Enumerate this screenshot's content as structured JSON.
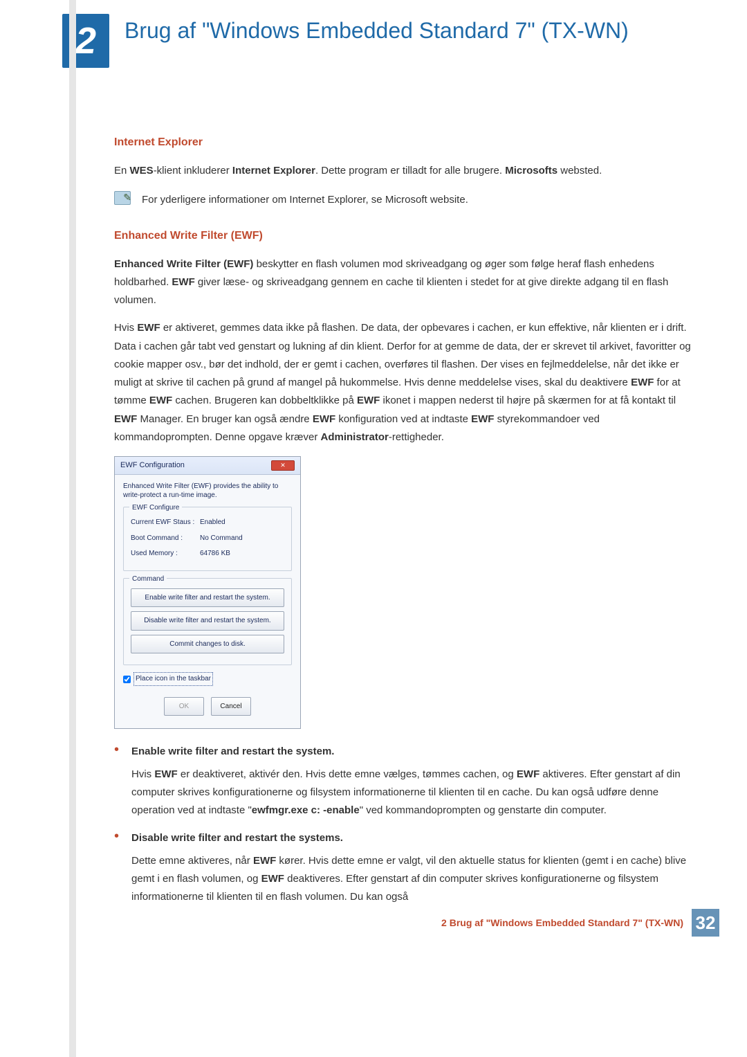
{
  "header": {
    "chapter_number": "2",
    "title": "Brug af \"Windows Embedded Standard 7\" (TX-WN)"
  },
  "section_ie": {
    "heading": "Internet Explorer",
    "para_parts": {
      "p1": "En ",
      "p2": "WES",
      "p3": "-klient inkluderer ",
      "p4": "Internet Explorer",
      "p5": ". Dette program er tilladt for alle brugere. ",
      "p6": "Microsofts",
      "p7": " websted."
    },
    "note": "For yderligere informationer om Internet Explorer, se Microsoft website."
  },
  "section_ewf": {
    "heading": "Enhanced Write Filter (EWF)",
    "para1_parts": {
      "a": "Enhanced Write Filter (EWF)",
      "b": " beskytter en flash volumen mod skriveadgang og øger som følge heraf flash enhedens holdbarhed. ",
      "c": "EWF",
      "d": " giver læse- og skriveadgang gennem en cache til klienten i stedet for at give direkte adgang til en flash volumen."
    },
    "para2_parts": {
      "a": "Hvis ",
      "b": "EWF",
      "c": " er aktiveret, gemmes data ikke på flashen. De data, der opbevares i cachen, er kun effektive, når klienten er i drift. Data i cachen går tabt ved genstart og lukning af din klient. Derfor for at gemme de data, der er skrevet til arkivet, favoritter og cookie mapper osv., bør det indhold, der er gemt i cachen, overføres til flashen. Der vises en fejlmeddelelse, når det ikke er muligt at skrive til cachen på grund af mangel på hukommelse. Hvis denne meddelelse vises, skal du deaktivere ",
      "d": "EWF",
      "e": " for at tømme ",
      "f": "EWF",
      "g": " cachen. Brugeren kan dobbeltklikke på ",
      "h": "EWF",
      "i": " ikonet i mappen nederst til højre på skærmen for at få kontakt til ",
      "j": "EWF",
      "k": " Manager. En bruger kan også ændre ",
      "l": "EWF",
      "m": " konfiguration ved at indtaste ",
      "n": "EWF",
      "o": " styrekommandoer ved kommandoprompten. Denne opgave kræver ",
      "p": "Administrator",
      "q": "-rettigheder."
    }
  },
  "dialog": {
    "title": "EWF Configuration",
    "description": "Enhanced Write Filter (EWF) provides the ability to write-protect a run-time image.",
    "group1_legend": "EWF Configure",
    "rows": {
      "status_label": "Current EWF Staus :",
      "status_value": "Enabled",
      "boot_label": "Boot Command :",
      "boot_value": "No Command",
      "mem_label": "Used Memory :",
      "mem_value": "64786 KB"
    },
    "group2_legend": "Command",
    "btn_enable": "Enable write filter and restart the system.",
    "btn_disable": "Disable write filter and restart the system.",
    "btn_commit": "Commit changes to disk.",
    "checkbox_label": "Place icon in the taskbar",
    "ok": "OK",
    "cancel": "Cancel"
  },
  "bullets": {
    "b1": {
      "title": "Enable write filter and restart the system.",
      "text_parts": {
        "a": "Hvis ",
        "b": "EWF",
        "c": " er deaktiveret, aktivér den. Hvis dette emne vælges, tømmes cachen, og ",
        "d": "EWF",
        "e": " aktiveres. Efter genstart af din computer skrives konfigurationerne og filsystem informationerne til klienten til en cache. Du kan også udføre denne operation ved at indtaste \"",
        "f": "ewfmgr.exe c: -enable",
        "g": "\" ved kommandoprompten og genstarte din computer."
      }
    },
    "b2": {
      "title": "Disable write filter and restart the systems.",
      "text_parts": {
        "a": "Dette emne aktiveres, når ",
        "b": "EWF",
        "c": " kører. Hvis dette emne er valgt, vil den aktuelle status for klienten (gemt i en cache) blive gemt i en flash volumen, og ",
        "d": "EWF",
        "e": " deaktiveres. Efter genstart af din computer skrives konfigurationerne og filsystem informationerne til klienten til en flash volumen. Du kan også"
      }
    }
  },
  "footer": {
    "text": "2 Brug af \"Windows Embedded Standard 7\" (TX-WN)",
    "page": "32"
  }
}
